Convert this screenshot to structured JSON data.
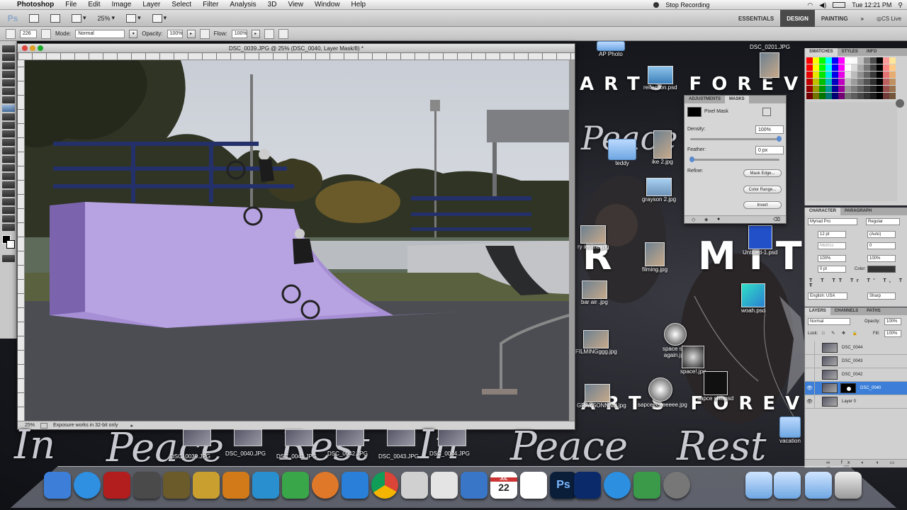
{
  "menubar": {
    "app": "Photoshop",
    "items": [
      "File",
      "Edit",
      "Image",
      "Layer",
      "Select",
      "Filter",
      "Analysis",
      "3D",
      "View",
      "Window",
      "Help"
    ],
    "recording": "Stop Recording",
    "clock": "Tue 12:21 PM"
  },
  "appbar": {
    "logo": "Ps",
    "zoom": "25%",
    "workspaces": [
      "ESSENTIALS",
      "DESIGN",
      "PAINTING"
    ],
    "active_workspace": "DESIGN",
    "cslive": "CS Live"
  },
  "options": {
    "brush_size": "226",
    "mode_label": "Mode:",
    "mode_value": "Normal",
    "opacity_label": "Opacity:",
    "opacity_value": "100%",
    "flow_label": "Flow:",
    "flow_value": "100%"
  },
  "document": {
    "title": "DSC_0039.JPG @ 25% (DSC_0040, Layer Mask/8) *",
    "status_zoom": "25%",
    "status_msg": "Exposure works in 32-bit only"
  },
  "desktop": {
    "top_label": "DSC_0201.JPG",
    "ap_photo": "AP Photo",
    "banner_top": "ARTS FOREVER",
    "banner_bottom": "ARTS FOREVER",
    "banner_mid": "MITC",
    "icons": [
      {
        "label": "relfection.psd"
      },
      {
        "label": "teddy"
      },
      {
        "label": "ike 2.jpg"
      },
      {
        "label": "grayson 2.jpg"
      },
      {
        "label": "ry incline.jpg"
      },
      {
        "label": "filming.jpg"
      },
      {
        "label": "Untitled-1.psd"
      },
      {
        "label": "bar air .jpg"
      },
      {
        "label": "woah.psd"
      },
      {
        "label": "FILMINGggg.jpg"
      },
      {
        "label": "space shit again.jpg"
      },
      {
        "label": "space!.jpg"
      },
      {
        "label": "GRAYSONNNN.jpg"
      },
      {
        "label": "sapceeeeeeeee.jpg"
      },
      {
        "label": "sapce shit.psd"
      },
      {
        "label": "vacation"
      }
    ],
    "dock_files": [
      "DSC_0039.JPG",
      "DSC_0040.JPG",
      "DSC_0041.JPG",
      "DSC_0042.JPG",
      "DSC_0043.JPG",
      "DSC_0044.JPG"
    ],
    "script_words": [
      "In",
      "Peace",
      "Rest",
      "In",
      "Peace",
      "Rest"
    ]
  },
  "masks": {
    "tabs": [
      "ADJUSTMENTS",
      "MASKS"
    ],
    "active_tab": "MASKS",
    "type": "Pixel Mask",
    "density_label": "Density:",
    "density_value": "100%",
    "feather_label": "Feather:",
    "feather_value": "0 px",
    "refine_label": "Refine:",
    "btn_mask_edge": "Mask Edge...",
    "btn_color_range": "Color Range...",
    "btn_invert": "Invert",
    "density": 1.0,
    "feather": 0.0
  },
  "swatches": {
    "tabs": [
      "SWATCHES",
      "STYLES",
      "INFO"
    ],
    "active_tab": "SWATCHES"
  },
  "character": {
    "tabs": [
      "CHARACTER",
      "PARAGRAPH"
    ],
    "active_tab": "CHARACTER",
    "font": "Myriad Pro",
    "style": "Regular",
    "size": "12 pt",
    "leading": "(Auto)",
    "kerning": "Metrics",
    "tracking": "0",
    "vscale": "100%",
    "hscale": "100%",
    "baseline": "0 pt",
    "color_label": "Color:",
    "language": "English: USA",
    "aa": "Sharp"
  },
  "layers": {
    "tabs": [
      "LAYERS",
      "CHANNELS",
      "PATHS"
    ],
    "active_tab": "LAYERS",
    "blend": "Normal",
    "opacity_label": "Opacity:",
    "opacity": "100%",
    "lock_label": "Lock:",
    "fill_label": "Fill:",
    "fill": "100%",
    "rows": [
      {
        "name": "DSC_0044",
        "visible": false,
        "selected": false
      },
      {
        "name": "DSC_0043",
        "visible": false,
        "selected": false
      },
      {
        "name": "DSC_0042",
        "visible": false,
        "selected": false
      },
      {
        "name": "DSC_0040",
        "visible": true,
        "selected": true
      },
      {
        "name": "Layer 0",
        "visible": true,
        "selected": false
      }
    ]
  },
  "dock": {
    "apps": [
      "finder-icon",
      "safari-icon",
      "photobooth-icon",
      "imovie-icon",
      "iphoto-icon",
      "garageband-icon",
      "iweb-icon",
      "numbers-icon",
      "pages-icon",
      "appstore-icon",
      "dashboard-icon",
      "chrome-icon",
      "preview-icon",
      "facetime-icon",
      "addressbook-icon",
      "ical-icon",
      "iphoto2-icon",
      "photoshop-icon",
      "itunes-icon",
      "timemachine-icon",
      "sysprefs-icon",
      "quicktime-icon"
    ],
    "ical_month": "JUL",
    "ical_day": "22",
    "ps_label": "Ps"
  },
  "colors": {
    "selection": "#3d7fd8",
    "accent_ws": "#4a4a4a",
    "ramp_purple": "#a78fd6"
  }
}
